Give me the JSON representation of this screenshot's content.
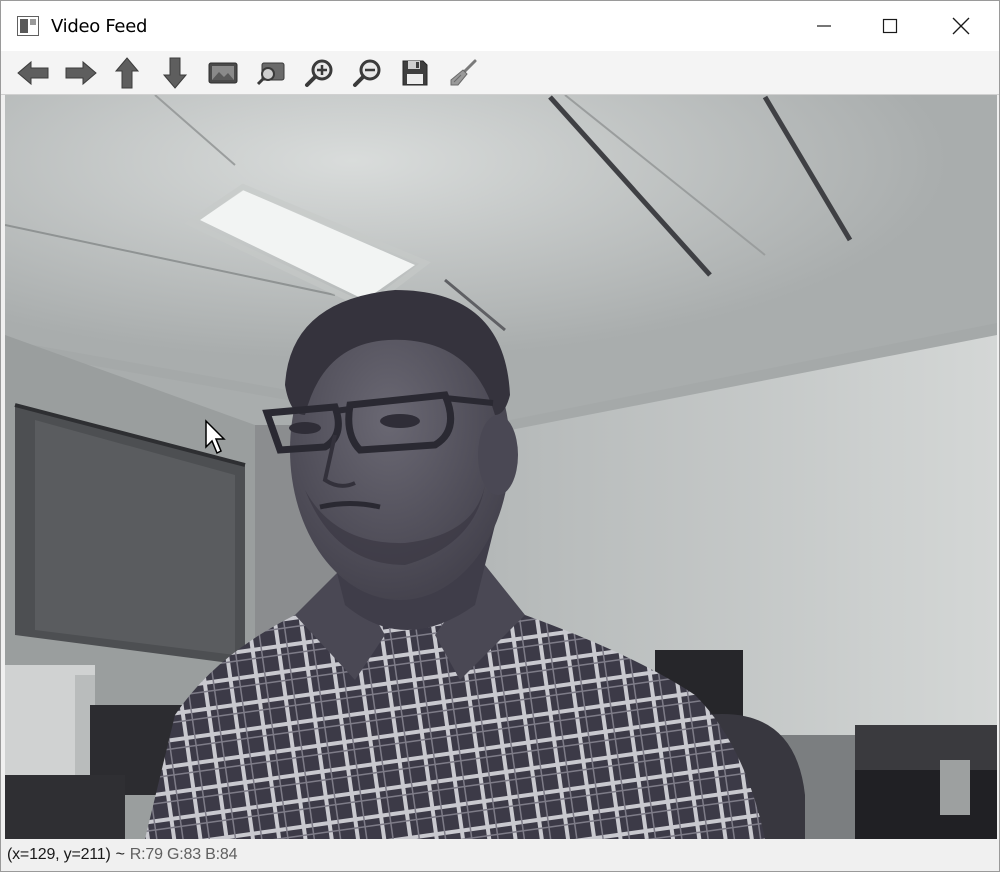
{
  "window": {
    "title": "Video Feed"
  },
  "title_bar_controls": {
    "minimize": "minimize-icon",
    "maximize": "maximize-icon",
    "close": "close-icon"
  },
  "toolbar": {
    "tools": [
      {
        "name": "pan-left",
        "icon": "arrow-left-icon"
      },
      {
        "name": "pan-right",
        "icon": "arrow-right-icon"
      },
      {
        "name": "pan-up",
        "icon": "arrow-up-icon"
      },
      {
        "name": "pan-down",
        "icon": "arrow-down-icon"
      },
      {
        "name": "zoom-to-fit",
        "icon": "image-fit-icon"
      },
      {
        "name": "zoom-area",
        "icon": "zoom-area-icon"
      },
      {
        "name": "zoom-in",
        "icon": "zoom-in-icon"
      },
      {
        "name": "zoom-out",
        "icon": "zoom-out-icon"
      },
      {
        "name": "save",
        "icon": "save-icon"
      },
      {
        "name": "properties",
        "icon": "brush-icon"
      }
    ]
  },
  "status": {
    "coords": "(x=129, y=211)",
    "separator": "~",
    "rgb": "R:79 G:83 B:84"
  },
  "colors": {
    "title_bar": "#ffffff",
    "toolbar": "#f4f4f4",
    "icon_gray": "#5a5a5a",
    "status_bar": "#f0f0f0"
  }
}
